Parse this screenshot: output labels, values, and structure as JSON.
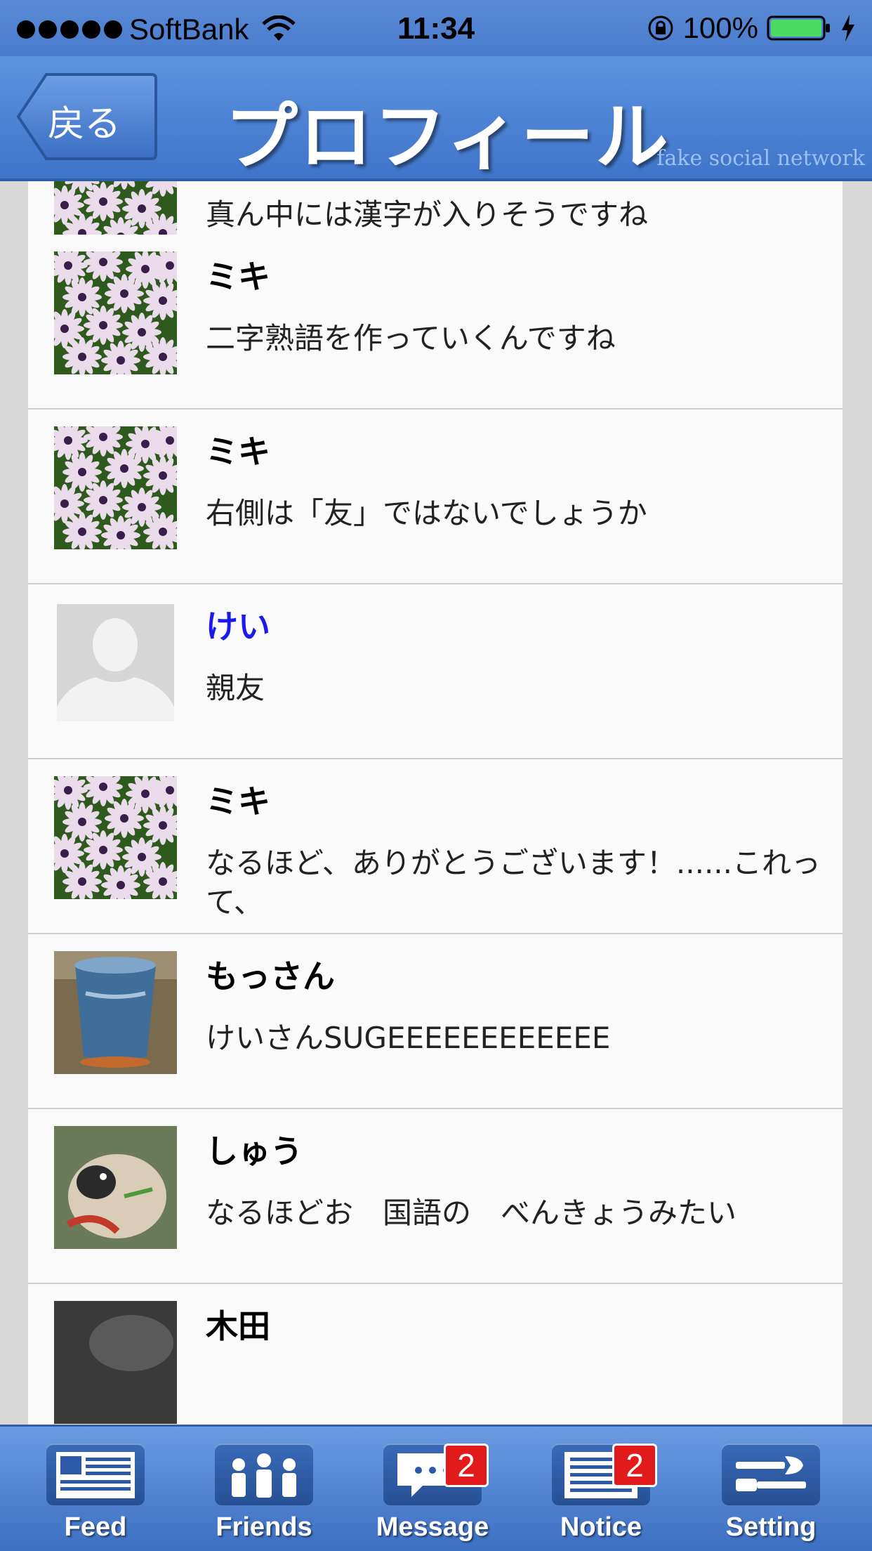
{
  "status_bar": {
    "carrier": "SoftBank",
    "time": "11:34",
    "battery": "100%"
  },
  "nav": {
    "back_label": "戻る",
    "title": "プロフィール",
    "watermark": "fake social network"
  },
  "comments": [
    {
      "user": "ミキ",
      "text": "真ん中には漢字が入りそうですね",
      "avatar": "flowers",
      "link": false
    },
    {
      "user": "ミキ",
      "text": "二字熟語を作っていくんですね",
      "avatar": "flowers",
      "link": false
    },
    {
      "user": "ミキ",
      "text": "右側は「友」ではないでしょうか",
      "avatar": "flowers",
      "link": false
    },
    {
      "user": "けい",
      "text": "親友",
      "avatar": "silhouette",
      "link": true
    },
    {
      "user": "ミキ",
      "text": "なるほど、ありがとうございます！......これって、",
      "avatar": "flowers",
      "link": false
    },
    {
      "user": "もっさん",
      "text": "けいさんSUGEEEEEEEEEEEE",
      "avatar": "cup",
      "link": false
    },
    {
      "user": "しゅう",
      "text": "なるほどお　国語の　べんきょうみたい",
      "avatar": "dog",
      "link": false
    },
    {
      "user": "木田",
      "text": "",
      "avatar": "dark",
      "link": false
    }
  ],
  "tabs": [
    {
      "label": "Feed",
      "icon": "feed-icon"
    },
    {
      "label": "Friends",
      "icon": "friends-icon"
    },
    {
      "label": "Message",
      "icon": "message-icon",
      "badge": "2"
    },
    {
      "label": "Notice",
      "icon": "notice-icon",
      "badge": "2"
    },
    {
      "label": "Setting",
      "icon": "setting-icon"
    }
  ],
  "colors": {
    "nav_blue": "#4a7cce",
    "link_blue": "#1a1aee",
    "badge_red": "#e11b1b"
  }
}
